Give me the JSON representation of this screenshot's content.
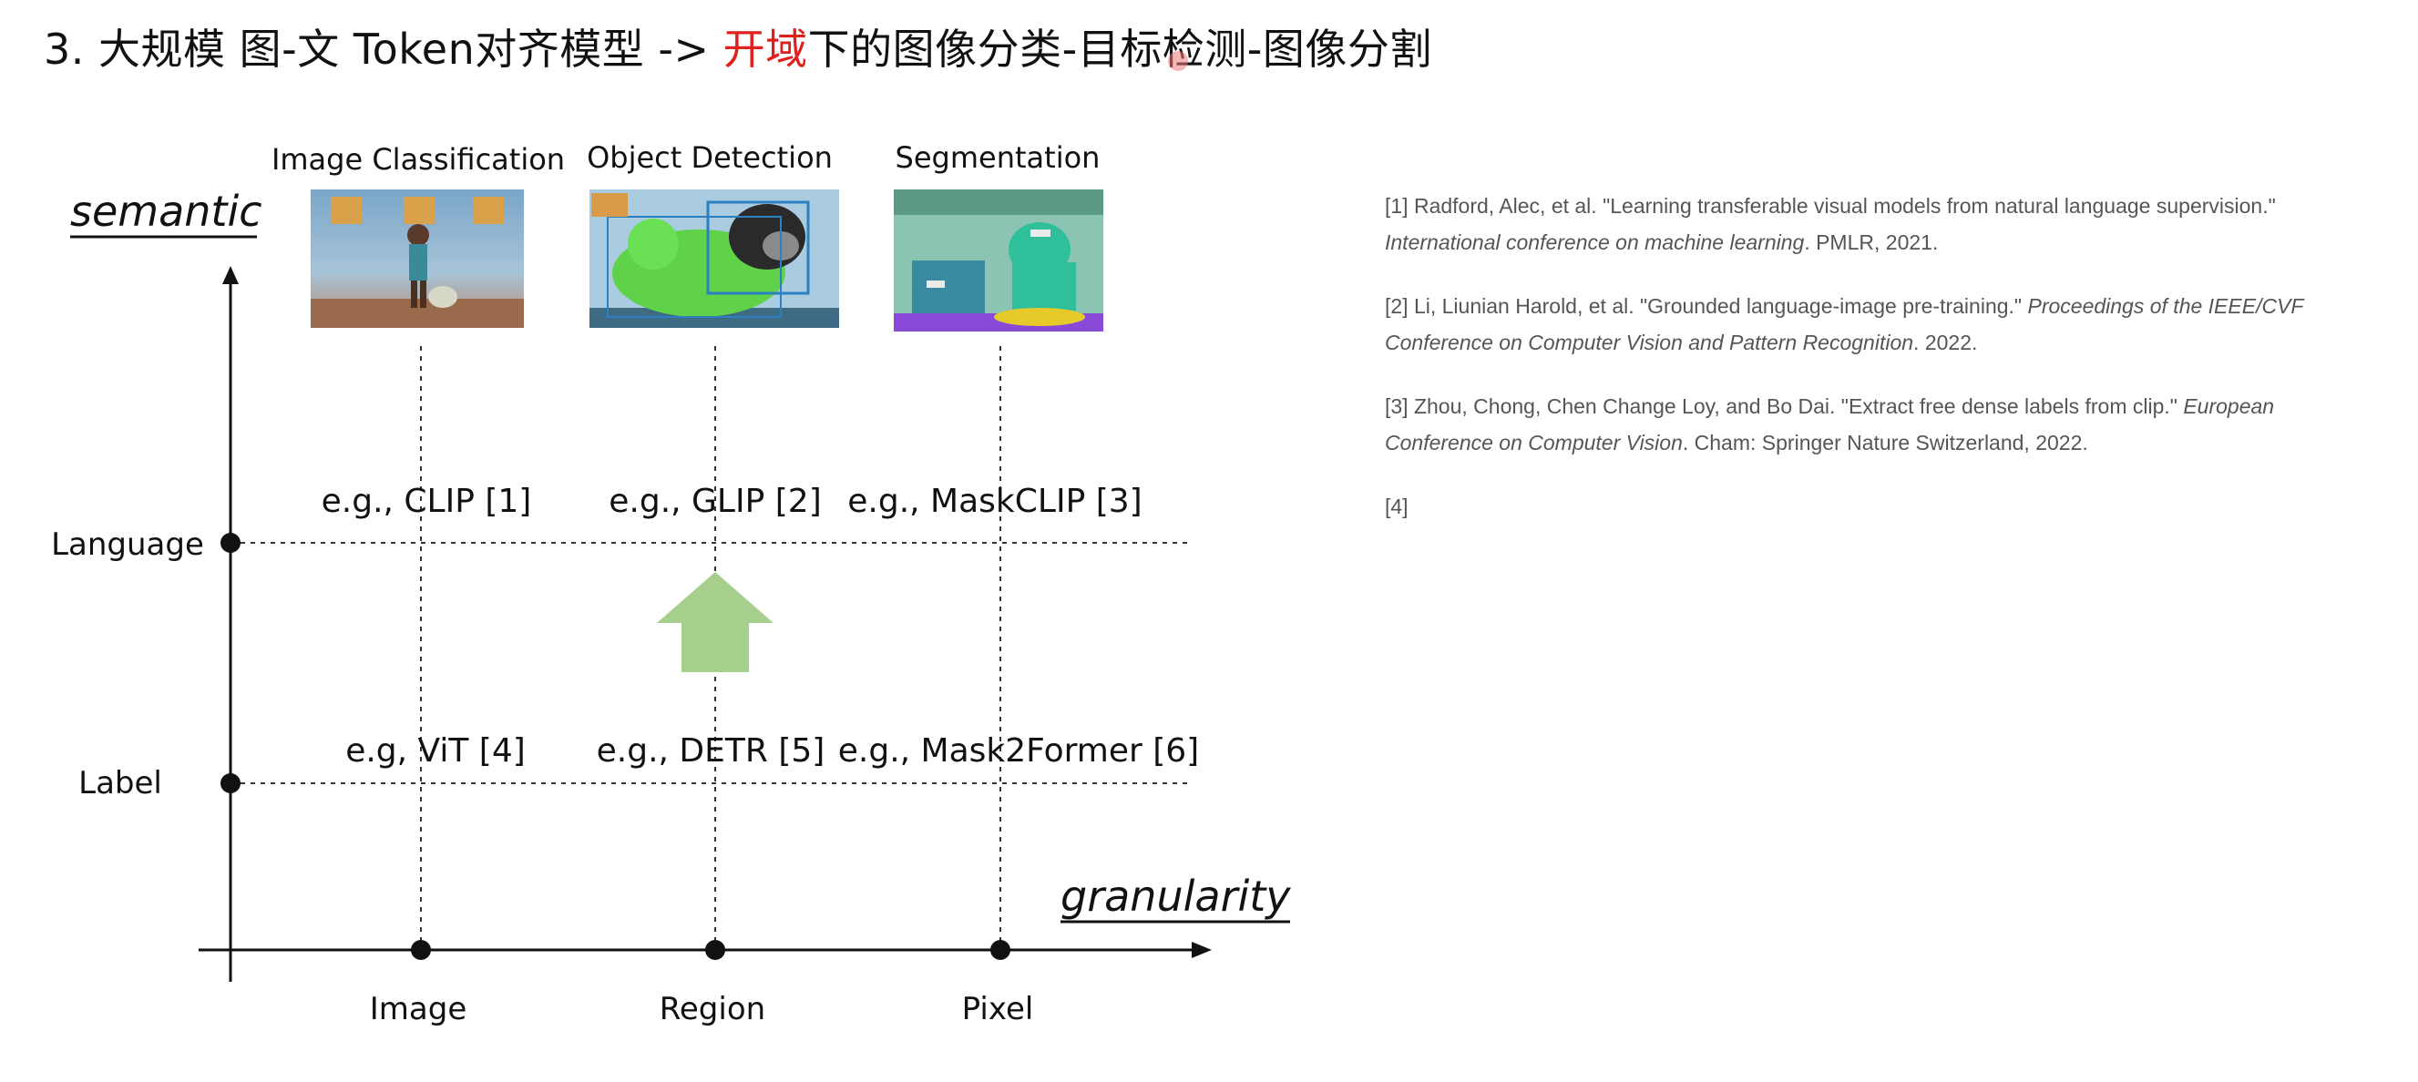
{
  "slide": {
    "title_prefix": "3. 大规模 图-文 Token对齐模型  -> ",
    "title_highlight": "开域",
    "title_suffix": "下的图像分类-目标检测-图像分割",
    "accent_color": "#e0201d"
  },
  "diagram": {
    "y_axis_label": "semantic",
    "x_axis_label": "granularity",
    "rows": [
      {
        "label": "Language",
        "examples": [
          "e.g., CLIP [1]",
          "e.g., GLIP [2]",
          "e.g., MaskCLIP [3]"
        ]
      },
      {
        "label": "Label",
        "examples": [
          "e.g, ViT [4]",
          "e.g., DETR [5]",
          "e.g., Mask2Former [6]"
        ]
      }
    ],
    "columns": [
      {
        "label": "Image",
        "task": "Image Classification"
      },
      {
        "label": "Region",
        "task": "Object Detection"
      },
      {
        "label": "Pixel",
        "task": "Segmentation"
      }
    ],
    "arrow_color": "#a6cf8e"
  },
  "references": [
    {
      "plain": "[1] Radford, Alec, et al. \"Learning transferable visual models from natural language supervision.\" ",
      "italic": "International conference on machine learning",
      "tail": ". PMLR, 2021."
    },
    {
      "plain": "[2] Li, Liunian Harold, et al. \"Grounded language-image pre-training.\" ",
      "italic": "Proceedings of the IEEE/CVF Conference on Computer Vision and Pattern Recognition",
      "tail": ". 2022."
    },
    {
      "plain": "[3] Zhou, Chong, Chen Change Loy, and Bo Dai. \"Extract free dense labels from clip.\" ",
      "italic": "European Conference on Computer Vision",
      "tail": ". Cham: Springer Nature Switzerland, 2022."
    },
    {
      "plain": "[4]",
      "italic": "",
      "tail": ""
    }
  ]
}
